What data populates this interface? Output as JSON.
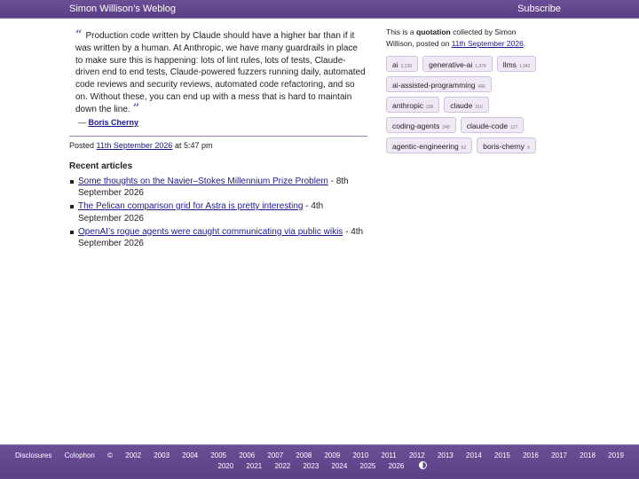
{
  "header": {
    "site_title": "Simon Willison’s Weblog",
    "subscribe_label": "Subscribe"
  },
  "quote": {
    "text": "Production code written by Claude should have a higher bar than if it was written by a human. At Anthropic, we have many guardrails in place to make sure this is happening: lots of lint rules, lots of tests, Claude-driven end to end tests, Claude-powered fuzzers running daily, automated code reviews and security reviews, automated code refactoring, and so on. Without these, you can end up with a mess that is hard to maintain down the line.",
    "open_mark": "“",
    "close_mark": "”",
    "attribution_prefix": "—",
    "author": "Boris Cherny"
  },
  "posted": {
    "prefix": "Posted",
    "date": "11th September 2026",
    "time_text": "at 5:47 pm"
  },
  "recent": {
    "heading": "Recent articles",
    "items": [
      {
        "title": "Some thoughts on the Navier–Stokes Millennium Prize Problem",
        "date": " - 8th September 2026"
      },
      {
        "title": "The Pelican comparison grid for Astra is pretty interesting",
        "date": " - 4th September 2026"
      },
      {
        "title": "OpenAI’s rogue agents were caught communicating via public wikis",
        "date": " - 4th September 2026"
      }
    ]
  },
  "sidebar": {
    "intro_before": "This is a ",
    "intro_bold": "quotation",
    "intro_mid": " collected by Simon Willison, posted on ",
    "intro_date": "11th September 2026",
    "intro_end": ".",
    "tags": [
      {
        "name": "ai",
        "count": "2,230"
      },
      {
        "name": "generative-ai",
        "count": "1,976"
      },
      {
        "name": "llms",
        "count": "1,942"
      },
      {
        "name": "ai-assisted-programming",
        "count": "406"
      },
      {
        "name": "anthropic",
        "count": "336"
      },
      {
        "name": "claude",
        "count": "310"
      },
      {
        "name": "coding-agents",
        "count": "248"
      },
      {
        "name": "claude-code",
        "count": "127"
      },
      {
        "name": "agentic-engineering",
        "count": "62"
      },
      {
        "name": "boris-cherny",
        "count": "4"
      }
    ]
  },
  "footer": {
    "links": [
      "Disclosures",
      "Colophon",
      "©"
    ],
    "years": [
      "2002",
      "2003",
      "2004",
      "2005",
      "2006",
      "2007",
      "2008",
      "2009",
      "2010",
      "2011",
      "2012",
      "2013",
      "2014",
      "2015",
      "2016",
      "2017",
      "2018",
      "2019",
      "2020",
      "2021",
      "2022",
      "2023",
      "2024",
      "2025",
      "2026"
    ],
    "contrast_icon": "contrast-toggle-icon"
  },
  "colors": {
    "header_bg": "#5b3f86",
    "accent": "#7a5aa8",
    "link": "#1a1a8c",
    "tag_bg": "#efe9f5"
  }
}
